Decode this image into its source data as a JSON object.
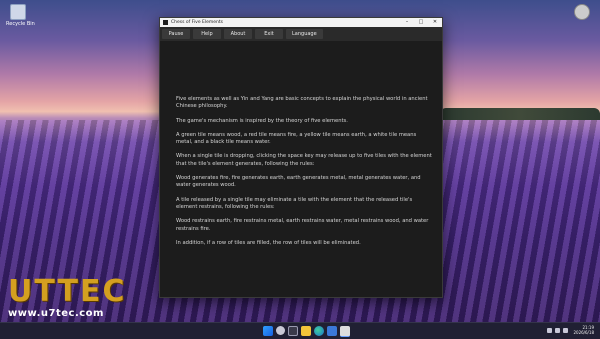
{
  "desktop": {
    "recycle_bin_label": "Recycle Bin",
    "watermark": {
      "logo": "UTTEC",
      "url": "www.u7tec.com"
    }
  },
  "window": {
    "title": "Chess of Five Elements",
    "controls": {
      "minimize": "–",
      "maximize": "□",
      "close": "✕"
    },
    "menu": [
      "Pause",
      "Help",
      "About",
      "Exit",
      "Language"
    ],
    "paragraphs": [
      "Five elements as well as Yin and Yang are basic concepts to explain the physical world in ancient Chinese philosophy.",
      "The game's mechanism is inspired by the theory of five elements.",
      "A green tile means wood, a red tile means fire, a yellow tile means earth, a white tile means metal, and a black tile means water.",
      "When a single tile is dropping, clicking the space key may release up to five tiles with the element that the tile's element generates, following the rules:",
      "Wood generates fire, fire generates earth, earth generates metal, metal generates water, and water generates wood.",
      "A tile released by a single tile may eliminate a tile with the element that the released tile's element restrains, following the rules:",
      "Wood restrains earth, fire restrains metal, earth restrains water, metal restrains wood, and water restrains fire.",
      "In addition, if a row of tiles are filled, the row of tiles will be eliminated."
    ]
  },
  "taskbar": {
    "icons": [
      "start-icon",
      "search-icon",
      "taskview-icon",
      "explorer-icon",
      "edge-icon",
      "store-icon",
      "app-task-icon"
    ],
    "time": "21:19",
    "date": "2026/6/18"
  }
}
